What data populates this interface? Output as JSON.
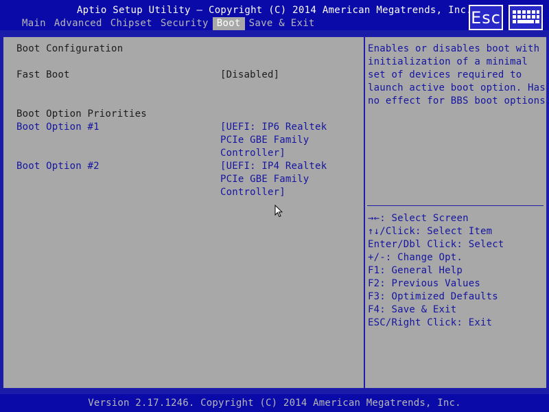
{
  "header": {
    "title": "Aptio Setup Utility – Copyright (C) 2014 American Megatrends, Inc.",
    "tabs": [
      "Main",
      "Advanced",
      "Chipset",
      "Security",
      "Boot",
      "Save & Exit"
    ],
    "active_tab": "Boot",
    "esc_label": "Esc",
    "esc_icon": "esc-key-icon",
    "keyboard_icon": "keyboard-icon"
  },
  "main": {
    "section_boot_config": "Boot Configuration",
    "fast_boot": {
      "label": "Fast Boot",
      "value": "[Disabled]"
    },
    "section_priorities": "Boot Option Priorities",
    "boot_options": [
      {
        "label": "Boot Option #1",
        "value_lines": [
          "[UEFI: IP6 Realtek",
          "PCIe GBE Family",
          "Controller]"
        ]
      },
      {
        "label": "Boot Option #2",
        "value_lines": [
          "[UEFI: IP4 Realtek",
          "PCIe GBE Family",
          "Controller]"
        ]
      }
    ]
  },
  "help": {
    "lines": [
      "Enables or disables boot with",
      "initialization of a minimal",
      "set of devices required to",
      "launch active boot option. Has",
      "no effect for BBS boot options."
    ]
  },
  "keys": [
    {
      "key": "→←",
      "desc": ": Select Screen"
    },
    {
      "key": "↑↓",
      "desc": "/Click: Select Item"
    },
    {
      "key": "",
      "desc": "Enter/Dbl Click: Select"
    },
    {
      "key": "",
      "desc": "+/-: Change Opt."
    },
    {
      "key": "",
      "desc": "F1: General Help"
    },
    {
      "key": "",
      "desc": "F2: Previous Values"
    },
    {
      "key": "",
      "desc": "F3: Optimized Defaults"
    },
    {
      "key": "",
      "desc": "F4: Save & Exit"
    },
    {
      "key": "",
      "desc": "ESC/Right Click: Exit"
    }
  ],
  "footer": {
    "text": "Version 2.17.1246. Copyright (C) 2014 American Megatrends, Inc."
  },
  "colors": {
    "header_bg": "#0a0aa8",
    "panel_bg": "#a8a8a8",
    "setting_blue": "#1414a0",
    "text_dark": "#1b1b1b",
    "active_tab_bg": "#a8a8a8"
  }
}
